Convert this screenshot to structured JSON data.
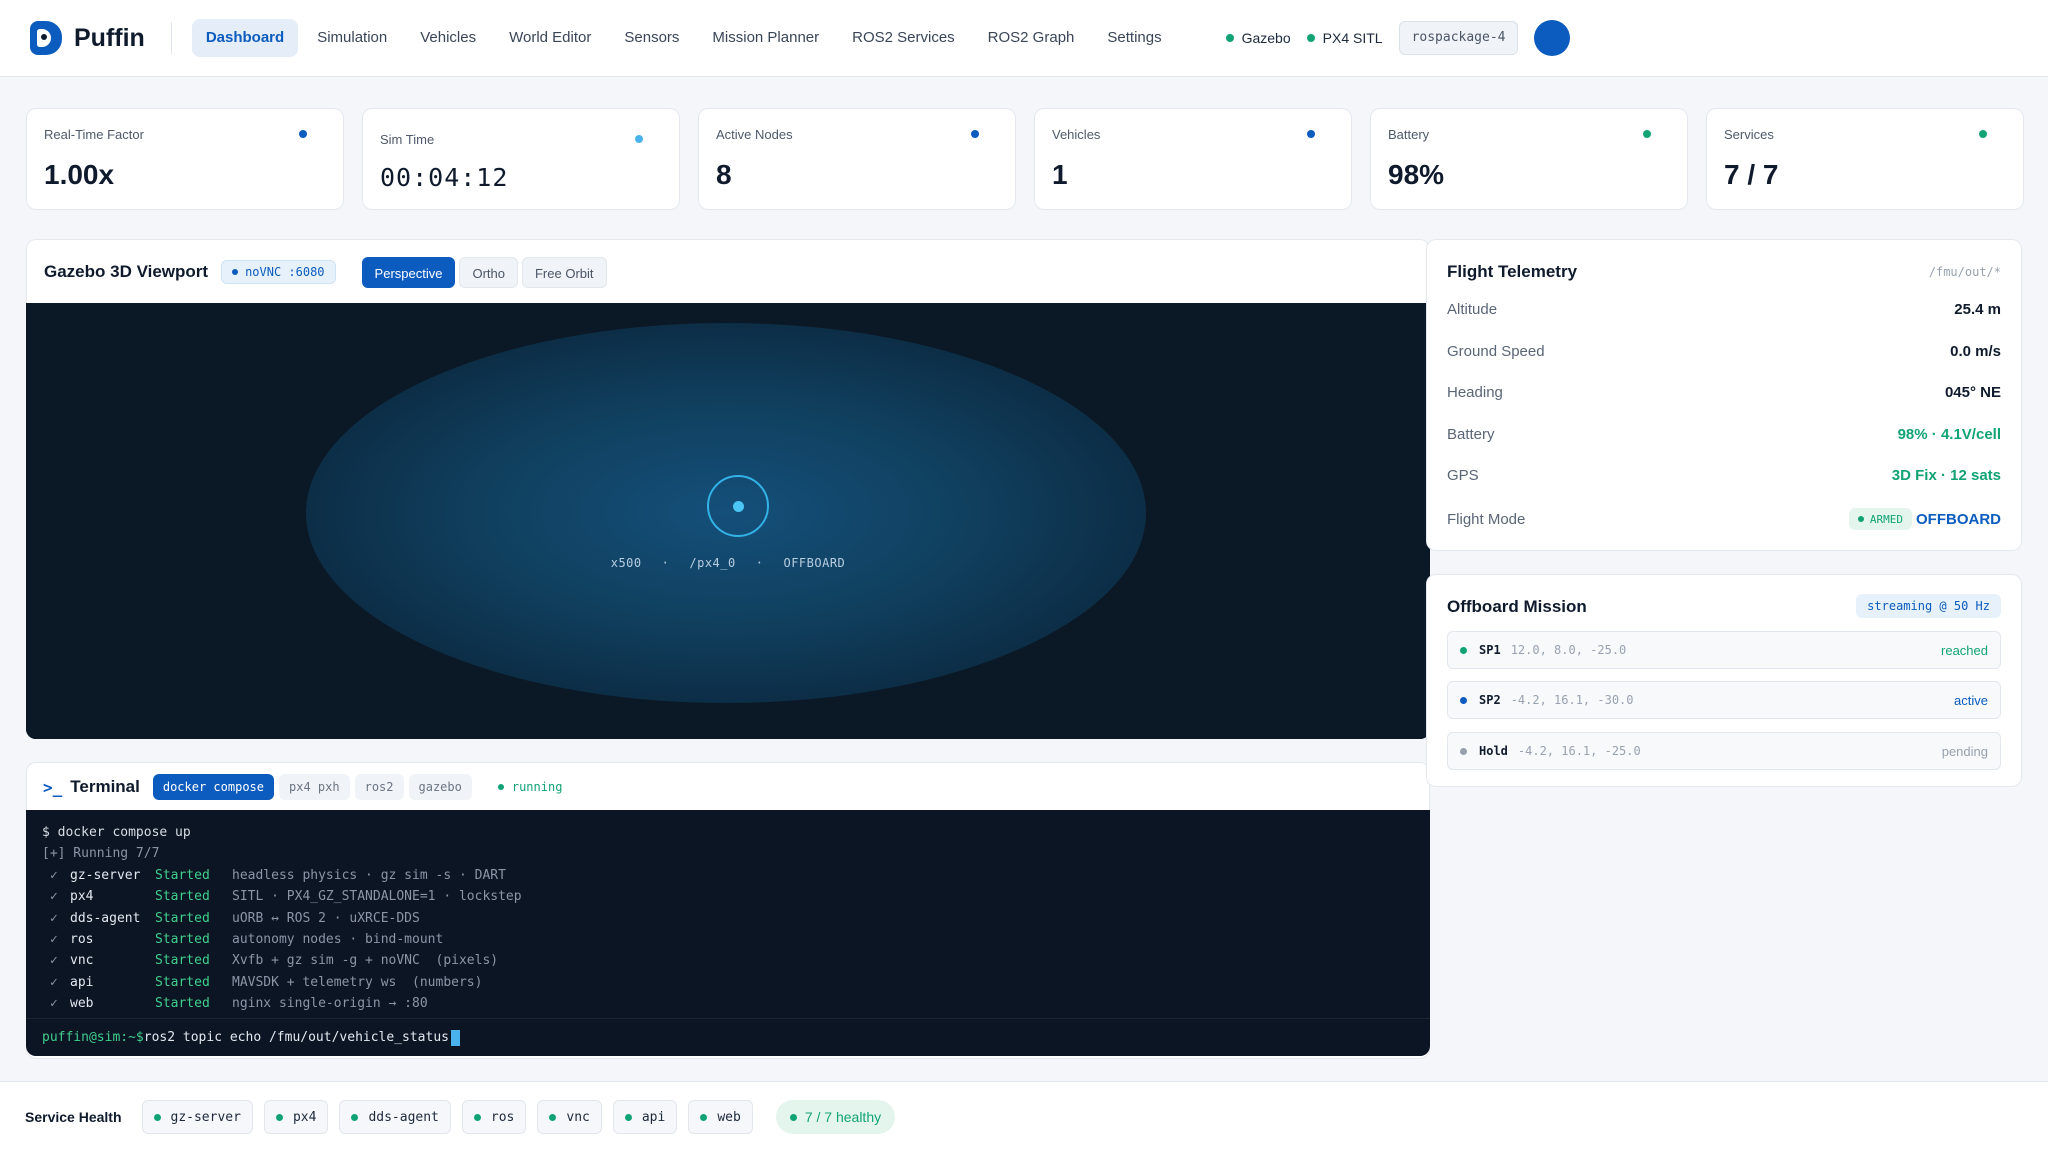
{
  "brand": {
    "name": "Puffin"
  },
  "nav": {
    "items": [
      {
        "label": "Dashboard",
        "active": true
      },
      {
        "label": "Simulation",
        "active": false
      },
      {
        "label": "Vehicles",
        "active": false
      },
      {
        "label": "World Editor",
        "active": false
      },
      {
        "label": "Sensors",
        "active": false
      },
      {
        "label": "Mission Planner",
        "active": false
      },
      {
        "label": "ROS2 Services",
        "active": false
      },
      {
        "label": "ROS2 Graph",
        "active": false
      },
      {
        "label": "Settings",
        "active": false
      }
    ]
  },
  "header_status": {
    "gazebo": "Gazebo",
    "px4": "PX4 SITL",
    "package": "rospackage-4"
  },
  "metrics": [
    {
      "label": "Real-Time Factor",
      "value": "1.00x",
      "dot_color": "#0b5cbe"
    },
    {
      "label": "Sim Time",
      "value": "00:04:12",
      "dot_color": "#4bb3ec"
    },
    {
      "label": "Active Nodes",
      "value": "8",
      "dot_color": "#0b5cbe"
    },
    {
      "label": "Vehicles",
      "value": "1",
      "dot_color": "#0b5cbe"
    },
    {
      "label": "Battery",
      "value": "98%",
      "dot_color": "#12a374"
    },
    {
      "label": "Services",
      "value": "7 / 7",
      "dot_color": "#12a374"
    }
  ],
  "viewport": {
    "title": "Gazebo 3D Viewport",
    "novnc": "noVNC :6080",
    "modes": [
      {
        "label": "Perspective",
        "active": true
      },
      {
        "label": "Ortho",
        "active": false
      },
      {
        "label": "Free Orbit",
        "active": false
      }
    ],
    "vehicle": {
      "model": "x500",
      "namespace": "/px4_0",
      "mode": "OFFBOARD",
      "sep": "·"
    }
  },
  "terminal": {
    "title": "Terminal",
    "glyph": ">_",
    "tabs": [
      {
        "label": "docker compose",
        "active": true
      },
      {
        "label": "px4 pxh",
        "active": false
      },
      {
        "label": "ros2",
        "active": false
      },
      {
        "label": "gazebo",
        "active": false
      }
    ],
    "state": "running",
    "command": "$ docker compose up",
    "running": "[+] Running 7/7",
    "services": [
      {
        "name": "gz-server",
        "status": "Started",
        "desc": "headless physics · gz sim -s · DART"
      },
      {
        "name": "px4",
        "status": "Started",
        "desc": "SITL · PX4_GZ_STANDALONE=1 · lockstep"
      },
      {
        "name": "dds-agent",
        "status": "Started",
        "desc": "uORB ↔ ROS 2 · uXRCE-DDS"
      },
      {
        "name": "ros",
        "status": "Started",
        "desc": "autonomy nodes · bind-mount"
      },
      {
        "name": "vnc",
        "status": "Started",
        "desc": "Xvfb + gz sim -g + noVNC  (pixels)"
      },
      {
        "name": "api",
        "status": "Started",
        "desc": "MAVSDK + telemetry ws  (numbers)"
      },
      {
        "name": "web",
        "status": "Started",
        "desc": "nginx single-origin → :80"
      }
    ],
    "prompt": "puffin@sim:~$",
    "input": "ros2 topic echo /fmu/out/vehicle_status"
  },
  "telemetry": {
    "title": "Flight Telemetry",
    "topic": "/fmu/out/*",
    "rows": [
      {
        "key": "Altitude",
        "value": "25.4 m"
      },
      {
        "key": "Ground Speed",
        "value": "0.0 m/s"
      },
      {
        "key": "Heading",
        "value": "045° NE"
      },
      {
        "key": "Battery",
        "value": "98%  ·  4.1V/cell"
      },
      {
        "key": "GPS",
        "value": "3D Fix · 12 sats"
      }
    ],
    "flight_mode": {
      "key": "Flight Mode",
      "armed": "ARMED",
      "mode": "OFFBOARD"
    }
  },
  "mission": {
    "title": "Offboard Mission",
    "stream": "streaming @ 50 Hz",
    "setpoints": [
      {
        "name": "SP1",
        "coords": "12.0, 8.0, -25.0",
        "state": "reached",
        "color": "#12a374"
      },
      {
        "name": "SP2",
        "coords": "-4.2, 16.1, -30.0",
        "state": "active",
        "color": "#0b5cbe"
      },
      {
        "name": "Hold",
        "coords": "-4.2, 16.1, -25.0",
        "state": "pending",
        "color": "#97a1ae"
      }
    ]
  },
  "health": {
    "label": "Service Health",
    "services": [
      "gz-server",
      "px4",
      "dds-agent",
      "ros",
      "vnc",
      "api",
      "web"
    ],
    "summary": "7 / 7 healthy"
  }
}
